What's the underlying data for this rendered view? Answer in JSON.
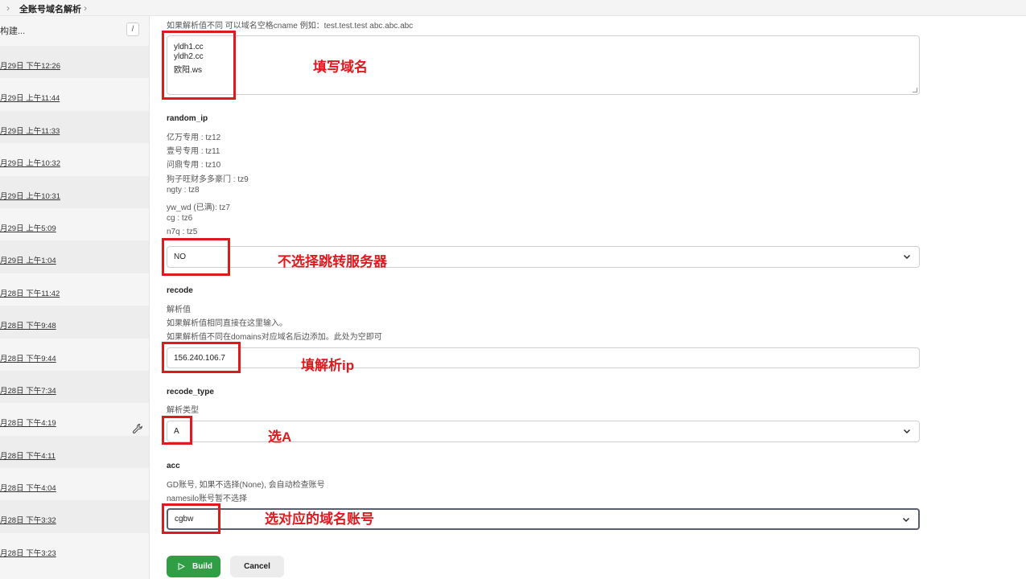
{
  "breadcrumb": {
    "job_name": "全账号域名解析"
  },
  "sidebar": {
    "filter_label": "构建...",
    "filter_shortcut": "/",
    "history": [
      "月29日 下午12:26",
      "月29日 上午11:44",
      "月29日 上午11:33",
      "月29日 上午10:32",
      "月29日 上午10:31",
      "月29日 上午5:09",
      "月29日 上午1:04",
      "月28日 下午11:42",
      "月28日 下午9:48",
      "月28日 下午9:44",
      "月28日 下午7:34",
      "月28日 下午4:19",
      "月28日 下午4:11",
      "月28日 下午4:04",
      "月28日 下午3:32",
      "月28日 下午3:23"
    ]
  },
  "form": {
    "domains": {
      "hint": "如果解析值不同 可以域名空格cname 例如：test.test.test abc.abc.abc",
      "values": [
        "yldh1.cc",
        "yldh2.cc",
        "欧阳.ws"
      ]
    },
    "random_ip": {
      "label": "random_ip",
      "options_desc": [
        "亿万专用 : tz12",
        "壹号专用 : tz11",
        "问鼎专用 : tz10",
        "狗子旺财多多豪门 : tz9",
        "ngty : tz8",
        "yw_wd (已满): tz7",
        "cg : tz6",
        "n7q : tz5"
      ],
      "value": "NO"
    },
    "recode": {
      "label": "recode",
      "desc": [
        "解析值",
        "如果解析值相同直接在这里输入。",
        "如果解析值不同在domains对应域名后边添加。此处为空即可"
      ],
      "value": "156.240.106.7"
    },
    "recode_type": {
      "label": "recode_type",
      "desc": "解析类型",
      "value": "A"
    },
    "acc": {
      "label": "acc",
      "desc": [
        "GD账号, 如果不选择(None), 会自动检查账号",
        "namesilo账号暂不选择"
      ],
      "value": "cgbw"
    },
    "build_label": "Build",
    "cancel_label": "Cancel"
  },
  "annotations": {
    "domains_note": "填写域名",
    "random_ip_note": "不选择跳转服务器",
    "recode_note": "填解析ip",
    "recode_type_note": "选A",
    "acc_note": "选对应的域名账号",
    "color": "#e0191e"
  },
  "colors": {
    "build_button": "#2f9e44",
    "sidebar_bg": "#f5f5f5"
  }
}
